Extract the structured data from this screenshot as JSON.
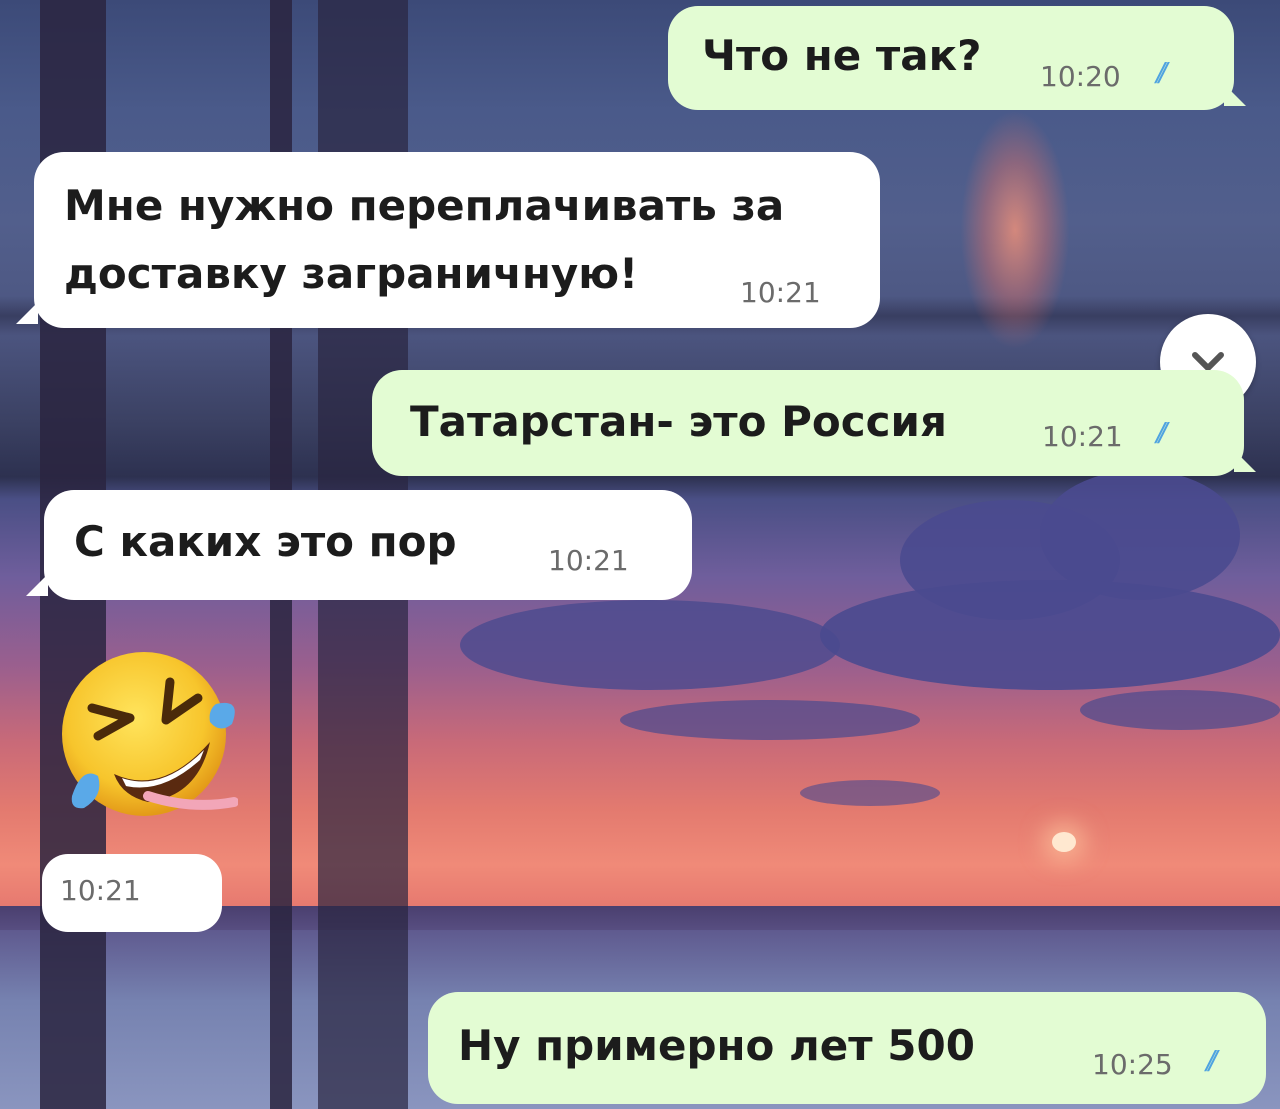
{
  "messages": [
    {
      "direction": "outgoing",
      "text_lines": [
        "Что не так?"
      ],
      "time": "10:20",
      "read_ticks": "//"
    },
    {
      "direction": "incoming",
      "text_lines": [
        "Мне нужно переплачивать за",
        "доставку заграничную!"
      ],
      "time": "10:21"
    },
    {
      "direction": "outgoing",
      "text_lines": [
        "Татарстан- это Россия"
      ],
      "time": "10:21",
      "read_ticks": "//"
    },
    {
      "direction": "incoming",
      "text_lines": [
        "С каких это пор"
      ],
      "time": "10:21"
    },
    {
      "direction": "incoming",
      "sticker": "rolling-on-the-floor-laughing-emoji",
      "time": "10:21"
    },
    {
      "direction": "outgoing",
      "text_lines": [
        "Ну примерно лет 500"
      ],
      "time": "10:25",
      "read_ticks": "//"
    }
  ],
  "scroll_button": {
    "icon": "chevron-down-icon"
  },
  "colors": {
    "outgoing_bubble": "#e3fcd3",
    "incoming_bubble": "#ffffff",
    "read_ticks": "#4fa3e0"
  }
}
